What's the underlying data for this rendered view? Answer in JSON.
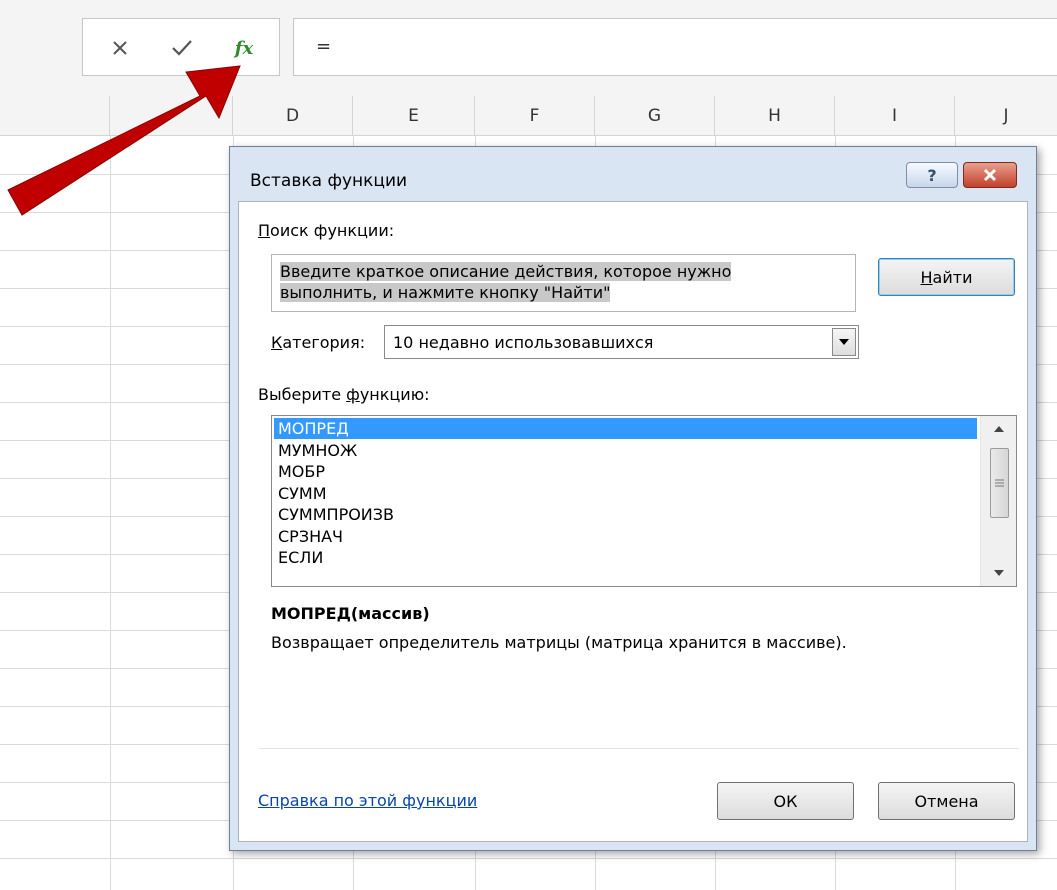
{
  "formula_bar": {
    "cancel_icon": "close-icon",
    "enter_icon": "checkmark-icon",
    "insert_function_label": "fx",
    "value": "="
  },
  "columns": [
    "D",
    "E",
    "F",
    "G",
    "H",
    "I",
    "J"
  ],
  "dialog": {
    "title": "Вставка функции",
    "help_label": "?",
    "search_label": "Поиск функции:",
    "search_text_line1": "Введите краткое описание действия, которое нужно",
    "search_text_line2": "выполнить, и нажмите кнопку \"Найти\"",
    "find_button": "Найти",
    "category_label": "Категория:",
    "category_value": "10 недавно использовавшихся",
    "select_function_label": "Выберите функцию:",
    "functions": [
      "МОПРЕД",
      "МУМНОЖ",
      "МОБР",
      "СУММ",
      "СУММПРОИЗВ",
      "СРЗНАЧ",
      "ЕСЛИ"
    ],
    "selected_index": 0,
    "signature": "МОПРЕД(массив)",
    "description": "Возвращает определитель матрицы (матрица хранится в массиве).",
    "help_link": "Справка по этой функции",
    "ok_button": "ОК",
    "cancel_button": "Отмена"
  },
  "colors": {
    "arrow": "#c00000",
    "selection": "#3399ff",
    "link": "#0645ad",
    "dialog_frame": "#dae5f3"
  }
}
